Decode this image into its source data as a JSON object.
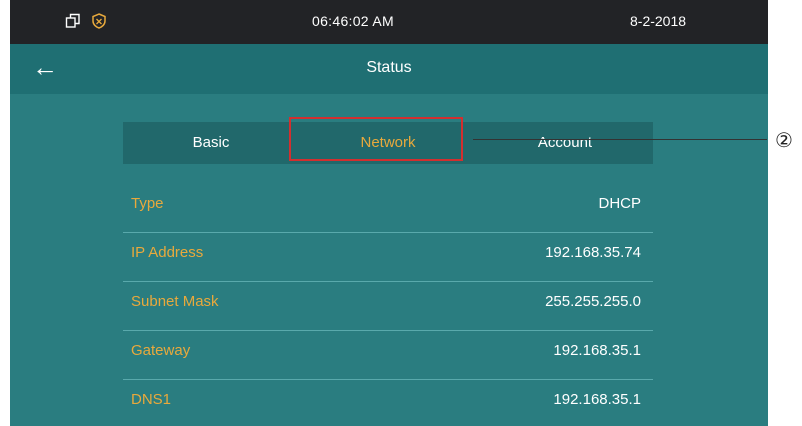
{
  "status_bar": {
    "icons": [
      "copy-window-icon",
      "shield-icon"
    ],
    "time": "06:46:02   AM",
    "date": "8-2-2018"
  },
  "header": {
    "back_icon": "←",
    "title": "Status"
  },
  "tabs": [
    {
      "label": "Basic",
      "active": false
    },
    {
      "label": "Network",
      "active": true
    },
    {
      "label": "Account",
      "active": false
    }
  ],
  "rows": [
    {
      "label": "Type",
      "value": "DHCP"
    },
    {
      "label": "IP Address",
      "value": "192.168.35.74"
    },
    {
      "label": "Subnet Mask",
      "value": "255.255.255.0"
    },
    {
      "label": "Gateway",
      "value": "192.168.35.1"
    },
    {
      "label": "DNS1",
      "value": "192.168.35.1"
    }
  ],
  "callout": {
    "number": "②"
  },
  "colors": {
    "background": "#2a7d80",
    "title_bar": "#1f6f73",
    "status_bar": "#222326",
    "label_accent": "#e8a93c",
    "highlight_box": "#d32f2f"
  }
}
